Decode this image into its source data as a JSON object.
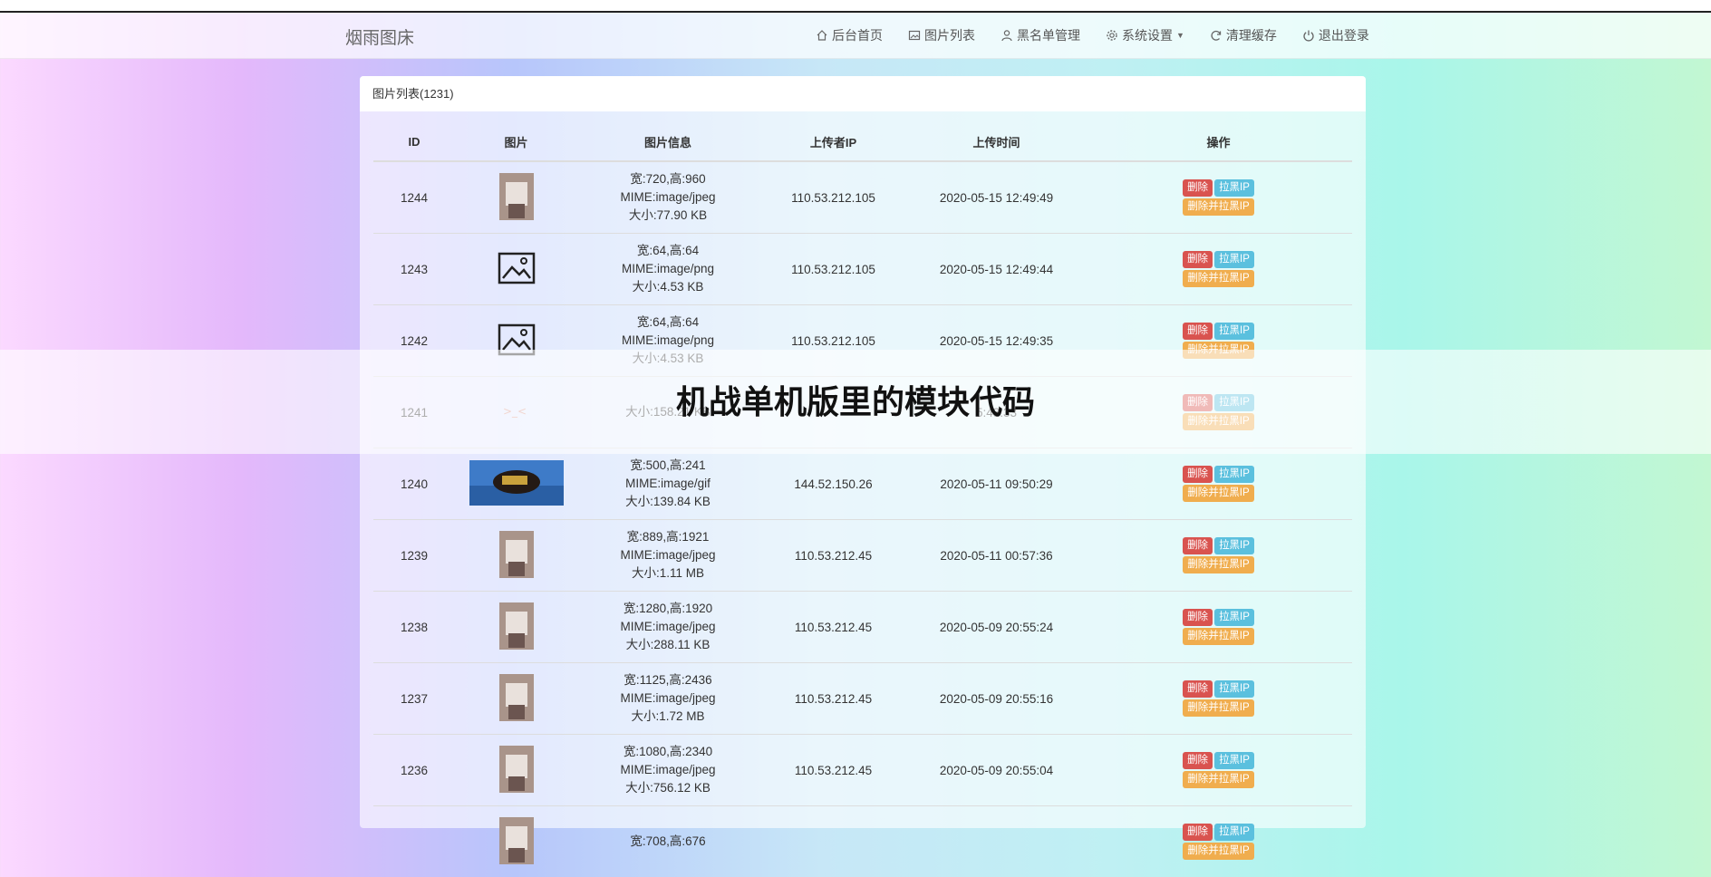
{
  "brand": "烟雨图床",
  "nav": [
    "后台首页",
    "图片列表",
    "黑名单管理",
    "系统设置",
    "清理缓存",
    "退出登录"
  ],
  "panel_title": "图片列表(1231)",
  "columns": [
    "ID",
    "图片",
    "图片信息",
    "上传者IP",
    "上传时间",
    "操作"
  ],
  "buttons": {
    "delete": "删除",
    "ban": "拉黑IP",
    "delete_ban": "删除并拉黑IP"
  },
  "rows": [
    {
      "id": "1244",
      "info": [
        "宽:720,高:960",
        "MIME:image/jpeg",
        "大小:77.90 KB"
      ],
      "ip": "110.53.212.105",
      "time": "2020-05-15 12:49:49",
      "thumb": "photo"
    },
    {
      "id": "1243",
      "info": [
        "宽:64,高:64",
        "MIME:image/png",
        "大小:4.53 KB"
      ],
      "ip": "110.53.212.105",
      "time": "2020-05-15 12:49:44",
      "thumb": "image-icon"
    },
    {
      "id": "1242",
      "info": [
        "宽:64,高:64",
        "MIME:image/png",
        "大小:4.53 KB"
      ],
      "ip": "110.53.212.105",
      "time": "2020-05-15 12:49:35",
      "thumb": "image-icon"
    },
    {
      "id": "1241",
      "info": [
        "",
        "",
        "大小:158.21 KB"
      ],
      "ip": "",
      "time": "5:43:33",
      "thumb": "emoji"
    },
    {
      "id": "1240",
      "info": [
        "宽:500,高:241",
        "MIME:image/gif",
        "大小:139.84 KB"
      ],
      "ip": "144.52.150.26",
      "time": "2020-05-11 09:50:29",
      "thumb": "wide"
    },
    {
      "id": "1239",
      "info": [
        "宽:889,高:1921",
        "MIME:image/jpeg",
        "大小:1.11 MB"
      ],
      "ip": "110.53.212.45",
      "time": "2020-05-11 00:57:36",
      "thumb": "photo"
    },
    {
      "id": "1238",
      "info": [
        "宽:1280,高:1920",
        "MIME:image/jpeg",
        "大小:288.11 KB"
      ],
      "ip": "110.53.212.45",
      "time": "2020-05-09 20:55:24",
      "thumb": "photo"
    },
    {
      "id": "1237",
      "info": [
        "宽:1125,高:2436",
        "MIME:image/jpeg",
        "大小:1.72 MB"
      ],
      "ip": "110.53.212.45",
      "time": "2020-05-09 20:55:16",
      "thumb": "photo"
    },
    {
      "id": "1236",
      "info": [
        "宽:1080,高:2340",
        "MIME:image/jpeg",
        "大小:756.12 KB"
      ],
      "ip": "110.53.212.45",
      "time": "2020-05-09 20:55:04",
      "thumb": "photo"
    },
    {
      "id": "",
      "info": [
        "宽:708,高:676",
        "",
        ""
      ],
      "ip": "",
      "time": "",
      "thumb": "photo"
    }
  ],
  "overlay_title": "机战单机版里的模块代码"
}
